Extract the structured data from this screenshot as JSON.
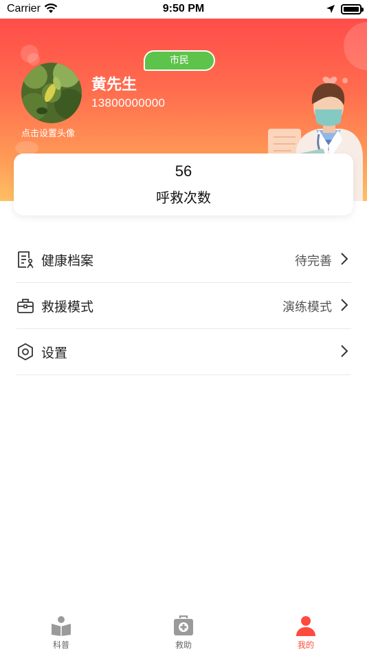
{
  "status_bar": {
    "carrier": "Carrier",
    "time": "9:50 PM"
  },
  "profile": {
    "avatar_hint": "点击设置头像",
    "name": "黄先生",
    "phone": "13800000000",
    "role_badge": "市民"
  },
  "stats": {
    "count": "56",
    "label": "呼救次数"
  },
  "menu": {
    "items": [
      {
        "label": "健康档案",
        "value": "待完善",
        "icon": "health-record-icon"
      },
      {
        "label": "救援模式",
        "value": "演练模式",
        "icon": "toolbox-icon"
      },
      {
        "label": "设置",
        "value": "",
        "icon": "hexagon-settings-icon"
      }
    ]
  },
  "tabs": [
    {
      "label": "科普",
      "icon": "reading-person-icon",
      "active": false
    },
    {
      "label": "救助",
      "icon": "first-aid-kit-icon",
      "active": false
    },
    {
      "label": "我的",
      "icon": "person-icon",
      "active": true
    }
  ],
  "colors": {
    "accent": "#ff4a3d",
    "badge": "#5ec34a",
    "header_top": "#ff4d4a",
    "header_bottom": "#ffbf63"
  }
}
